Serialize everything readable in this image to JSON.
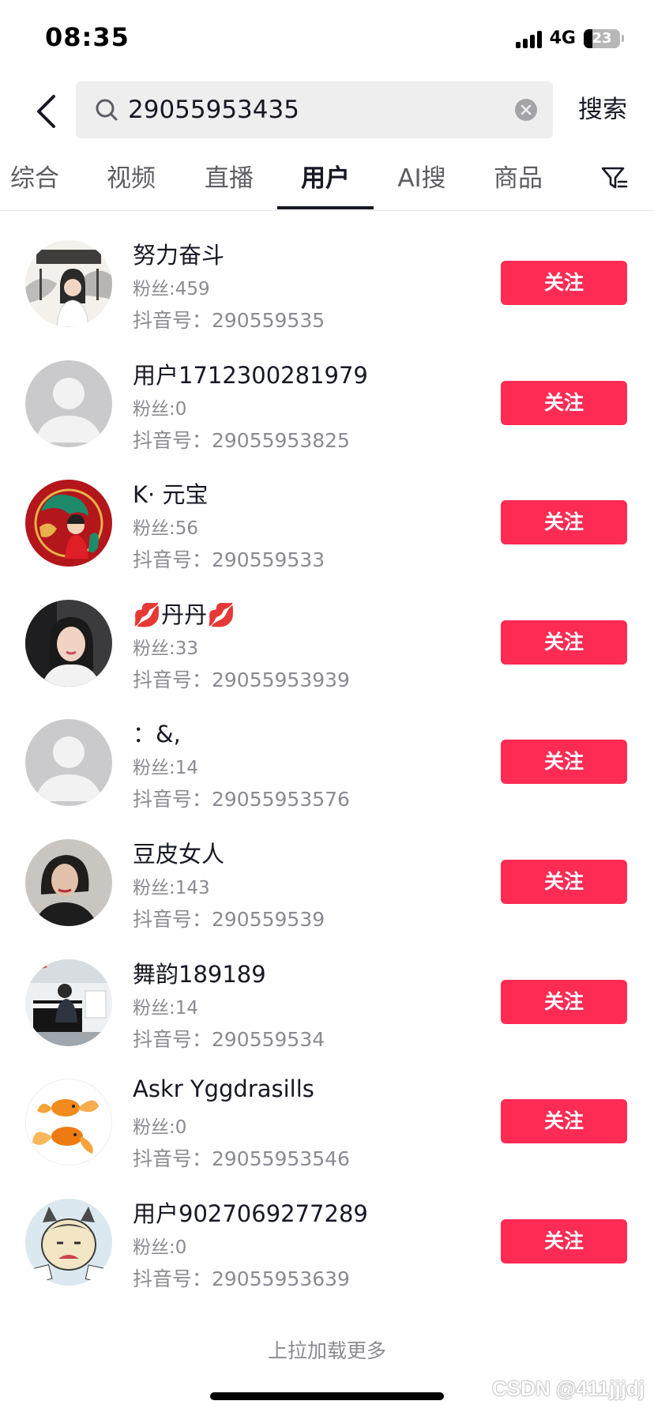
{
  "status_bar": {
    "time": "08:35",
    "network": "4G",
    "battery": "23",
    "battery_fraction": 0.23,
    "signal_icon": "signal-bars-icon"
  },
  "search": {
    "query": "29055953435",
    "submit_label": "搜索",
    "icons": [
      "back-icon",
      "search-icon",
      "clear-icon",
      "filter-icon"
    ]
  },
  "tabs": [
    {
      "label": "综合"
    },
    {
      "label": "视频"
    },
    {
      "label": "直播"
    },
    {
      "label": "用户"
    },
    {
      "label": "AI搜"
    },
    {
      "label": "商品"
    }
  ],
  "active_tab": "用户",
  "users": [
    {
      "name": "努力奋斗",
      "fans": "粉丝:459",
      "douyin_id": "抖音号：290559535",
      "follow": "关注",
      "avatar": "calligraphy-portrait"
    },
    {
      "name": "用户1712300281979",
      "fans": "粉丝:0",
      "douyin_id": "抖音号：29055953825",
      "follow": "关注",
      "avatar": "default-user"
    },
    {
      "name": "K· 元宝",
      "fans": "粉丝:56",
      "douyin_id": "抖音号：290559533",
      "follow": "关注",
      "avatar": "red-dragon"
    },
    {
      "name": "💋丹丹💋",
      "fans": "粉丝:33",
      "douyin_id": "抖音号：29055953939",
      "follow": "关注",
      "avatar": "woman-portrait"
    },
    {
      "name": "：&,",
      "fans": "粉丝:14",
      "douyin_id": "抖音号：29055953576",
      "follow": "关注",
      "avatar": "default-user"
    },
    {
      "name": "豆皮女人",
      "fans": "粉丝:143",
      "douyin_id": "抖音号：290559539",
      "follow": "关注",
      "avatar": "woman-dark-portrait"
    },
    {
      "name": "舞韵189189",
      "fans": "粉丝:14",
      "douyin_id": "抖音号：290559534",
      "follow": "关注",
      "avatar": "piano-room"
    },
    {
      "name": "Askr Yggdrasills",
      "fans": "粉丝:0",
      "douyin_id": "抖音号：29055953546",
      "follow": "关注",
      "avatar": "goldfish"
    },
    {
      "name": "用户9027069277289",
      "fans": "粉丝:0",
      "douyin_id": "抖音号：29055953639",
      "follow": "关注",
      "avatar": "cartoon-character"
    }
  ],
  "footer": {
    "load_more": "上拉加载更多",
    "watermark": "CSDN @411jjjdj"
  },
  "colors": {
    "accent": "#fe2c55",
    "text": "#161823",
    "secondary_text": "#8a8b91",
    "search_bg": "#eeeeef"
  }
}
